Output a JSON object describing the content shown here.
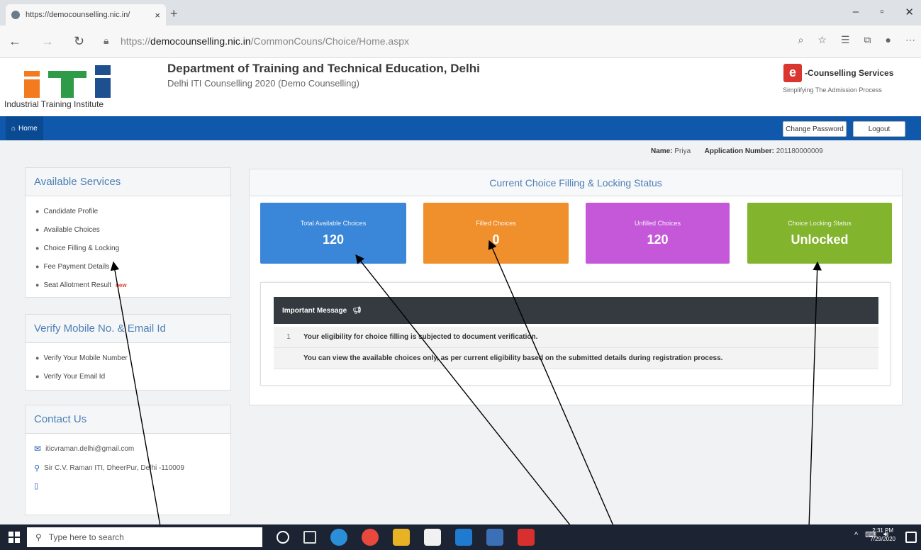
{
  "browser": {
    "tab_title": "https://democounselling.nic.in/",
    "tab_close": "×",
    "new_tab": "+",
    "url_prefix": "https://",
    "url_domain": "democounselling.nic.in",
    "url_path": "/CommonCouns/Choice/Home.aspx"
  },
  "header": {
    "logo_text": "Industrial Training Institute",
    "title": "Department of Training and Technical Education, Delhi",
    "subtitle": "Delhi ITI Counselling 2020 (Demo Counselling)",
    "ecs_logo": "e",
    "ecs_title": "-Counselling Services",
    "ecs_tagline": "Simplifying The Admission Process"
  },
  "navbar": {
    "home_label": "Home",
    "change_password": "Change Password",
    "logout": "Logout"
  },
  "user": {
    "name_label": "Name:",
    "name": "Priya",
    "app_label": "Application Number:",
    "app_number": "201180000009"
  },
  "sidebar": {
    "services_title": "Available Services",
    "services": [
      {
        "label": "Candidate Profile"
      },
      {
        "label": "Available Choices"
      },
      {
        "label": "Choice Filling & Locking"
      },
      {
        "label": "Fee Payment Details"
      },
      {
        "label": "Seat Allotment Result",
        "badge": "new"
      }
    ],
    "verify_title": "Verify Mobile No. & Email Id",
    "verify": [
      {
        "label": "Verify Your Mobile Number"
      },
      {
        "label": "Verify Your Email Id"
      }
    ],
    "contact_title": "Contact Us",
    "email": "iticvraman.delhi@gmail.com",
    "address": "Sir C.V. Raman ITI, DheerPur, Delhi -110009"
  },
  "status": {
    "title": "Current Choice Filling & Locking Status",
    "cards": [
      {
        "label": "Total Available Choices",
        "value": "120",
        "color": "#3a86d8"
      },
      {
        "label": "Filled Choices",
        "value": "0",
        "color": "#f0902c"
      },
      {
        "label": "Unfilled Choices",
        "value": "120",
        "color": "#c558d9"
      },
      {
        "label": "Choice Locking Status",
        "value": "Unlocked",
        "color": "#82b42d"
      }
    ]
  },
  "message": {
    "title": "Important Message",
    "row_number": "1",
    "lines": [
      "Your eligibility for choice filling is subjected to document verification.",
      "You can view the available choices only, as per current eligibility based on the submitted details during registration process."
    ]
  },
  "taskbar": {
    "search_placeholder": "Type here to search",
    "time": "2:31 PM",
    "date": "7/29/2020"
  }
}
